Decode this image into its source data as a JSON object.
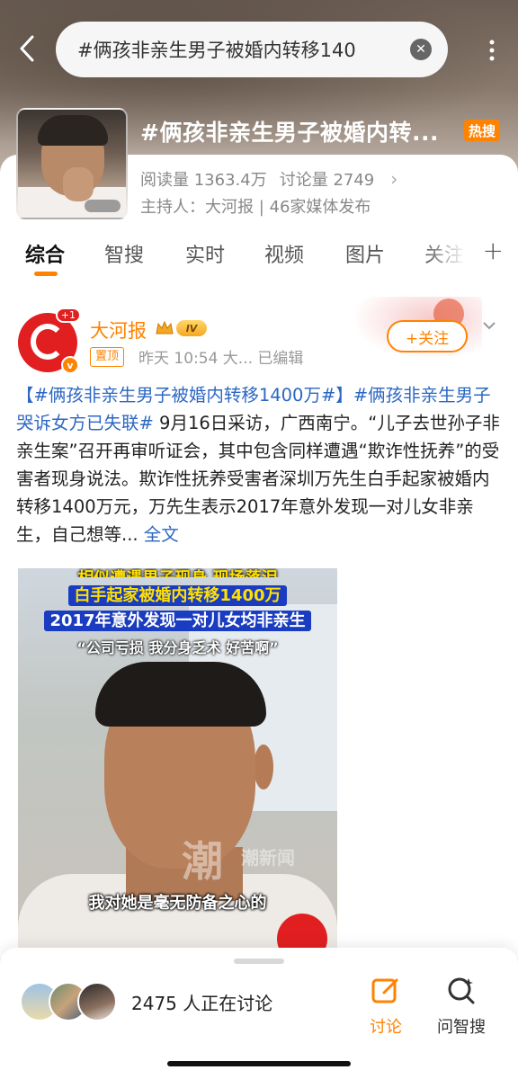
{
  "search": {
    "query": "#俩孩非亲生男子被婚内转移140"
  },
  "topic": {
    "title": "#俩孩非亲生男子被婚内转...",
    "badge": "热搜",
    "reads": "阅读量 1363.4万",
    "discussions": "讨论量 2749",
    "host": "主持人：大河报 | 46家媒体发布"
  },
  "tabs": [
    "综合",
    "智搜",
    "实时",
    "视频",
    "图片",
    "关注"
  ],
  "post": {
    "author": "大河报",
    "level": "IV",
    "avatar_plus": "+1",
    "pinned": "置顶",
    "meta": "昨天 10:54  大...  已编辑",
    "follow": "+关注",
    "text_parts": {
      "topic1": "【#俩孩非亲生男子被婚内转移1400万#】",
      "topic2": "#俩孩非亲生男子哭诉女方已失联#",
      "body": " 9月16日采访，广西南宁。“儿子去世孙子非亲生案”召开再审听证会，其中包含同样遭遇“欺诈性抚养”的受害者现身说法。欺诈性抚养受害者深圳万先生白手起家被婚内转移1400万元，万先生表示2017年意外发现一对儿女非亲生，自己想等...",
      "more": " 全文"
    },
    "video": {
      "cap1": "相似遭遇男子现身 现场落泪",
      "cap2": "白手起家被婚内转移1400万",
      "cap3": "2017年意外发现一对儿女均非亲生",
      "cap4": "“公司亏损 我分身乏术 好苦啊”",
      "watermark": "潮",
      "watermark2": "潮新闻",
      "subtitle": "我对她是毫无防备之心的"
    }
  },
  "bottom": {
    "count": "2475 人正在讨论",
    "discuss": "讨论",
    "ask": "问智搜"
  },
  "colors": {
    "accent": "#ff8200",
    "link": "#2c67c3",
    "brand_red": "#e21f20"
  }
}
